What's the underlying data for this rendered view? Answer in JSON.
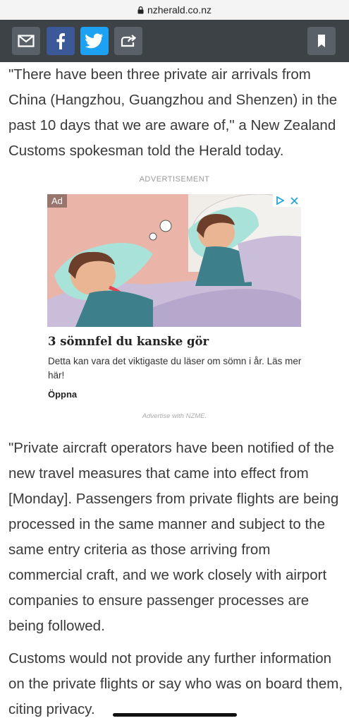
{
  "browser": {
    "url": "nzherald.co.nz",
    "lock_icon": "lock-icon"
  },
  "toolbar": {
    "buttons": [
      {
        "name": "email-share-button",
        "icon": "envelope-icon",
        "color": "#5a6068"
      },
      {
        "name": "facebook-share-button",
        "icon": "facebook-icon",
        "color": "#3b5998"
      },
      {
        "name": "twitter-share-button",
        "icon": "twitter-icon",
        "color": "#1da1f2"
      },
      {
        "name": "share-button",
        "icon": "share-arrow-icon",
        "color": "#5a6068"
      },
      {
        "name": "bookmark-button",
        "icon": "bookmark-icon",
        "color": "#5a6068"
      }
    ],
    "background": "#3d4247"
  },
  "article": {
    "paragraph_1": "\"There have been three private air arrivals from China (Hangzhou, Guangzhou and Shenzen) in the past 10 days that we are aware of,\" a New Zealand Customs spokesman told the Herald today.",
    "paragraph_2": "\"Private aircraft operators have been notified of the new travel measures that came into effect from [Monday]. Passengers from private flights are being processed in the same manner and subject to the same entry criteria as those arriving from commercial craft, and we work closely with airport companies to ensure passenger processes are being followed.",
    "paragraph_3": "Customs would not provide any further information on the private flights or say who was on board them, citing privacy."
  },
  "advert": {
    "label": "ADVERTISEMENT",
    "badge": "Ad",
    "headline": "3 sömnfel du kanske gör",
    "description": "Detta kan vara det viktigaste du läser om sömn i år. Läs mer här!",
    "cta": "Öppna",
    "footer": "Advertise with NZME."
  }
}
